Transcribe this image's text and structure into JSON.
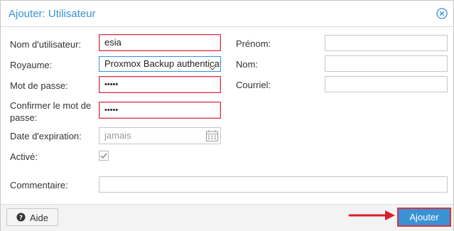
{
  "dialog": {
    "title": "Ajouter: Utilisateur",
    "close_icon": "close-circle-icon"
  },
  "form": {
    "username": {
      "label": "Nom d'utilisateur:",
      "value": "esia"
    },
    "realm": {
      "label": "Royaume:",
      "value": "Proxmox Backup authentication server"
    },
    "password": {
      "label": "Mot de passe:",
      "value": "•••••"
    },
    "confirm_password": {
      "label": "Confirmer le mot de passe:",
      "value": "•••••"
    },
    "expiration": {
      "label": "Date d'expiration:",
      "placeholder": "jamais",
      "icon": "calendar-icon"
    },
    "enabled": {
      "label": "Activé:",
      "checked": true
    },
    "firstname": {
      "label": "Prénom:",
      "value": ""
    },
    "lastname": {
      "label": "Nom:",
      "value": ""
    },
    "email": {
      "label": "Courriel:",
      "value": ""
    },
    "comment": {
      "label": "Commentaire:",
      "value": ""
    }
  },
  "footer": {
    "help_label": "Aide",
    "help_icon": "question-circle-icon",
    "add_label": "Ajouter"
  },
  "colors": {
    "accent": "#3892d4",
    "invalid_border": "#d6344a",
    "annotation_arrow": "#d6202f"
  }
}
